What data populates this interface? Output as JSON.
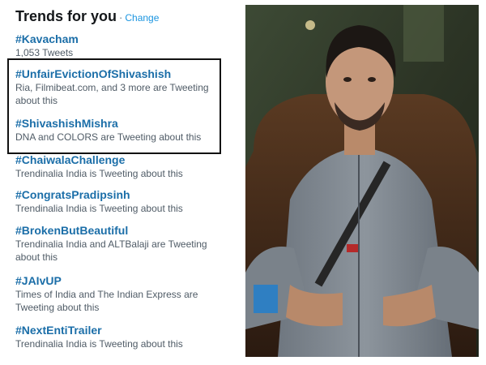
{
  "header": {
    "title": "Trends for you",
    "separator": "·",
    "change_label": "Change"
  },
  "trends": [
    {
      "tag": "#Kavacham",
      "meta": "1,053 Tweets"
    },
    {
      "tag": "#UnfairEvictionOfShivashish",
      "meta": "Ria, Filmibeat.com, and 3 more are Tweeting about this"
    },
    {
      "tag": "#ShivashishMishra",
      "meta": "DNA and COLORS are Tweeting about this"
    },
    {
      "tag": "#ChaiwalaChallenge",
      "meta": "Trendinalia India is Tweeting about this"
    },
    {
      "tag": "#CongratsPradipsinh",
      "meta": "Trendinalia India is Tweeting about this"
    },
    {
      "tag": "#BrokenButBeautiful",
      "meta": "Trendinalia India and ALTBalaji are Tweeting about this"
    },
    {
      "tag": "#JAIvUP",
      "meta": "Times of India and The Indian Express are Tweeting about this"
    },
    {
      "tag": "#NextEntiTrailer",
      "meta": "Trendinalia India is Tweeting about this"
    }
  ],
  "colors": {
    "tag_blue": "#1b6ea8",
    "link_blue": "#1b95e0",
    "meta_gray": "#4f5b66",
    "highlight_border": "#111111"
  },
  "photo": {
    "subject": "man seated in dark chair wearing gray zip-up jacket"
  }
}
